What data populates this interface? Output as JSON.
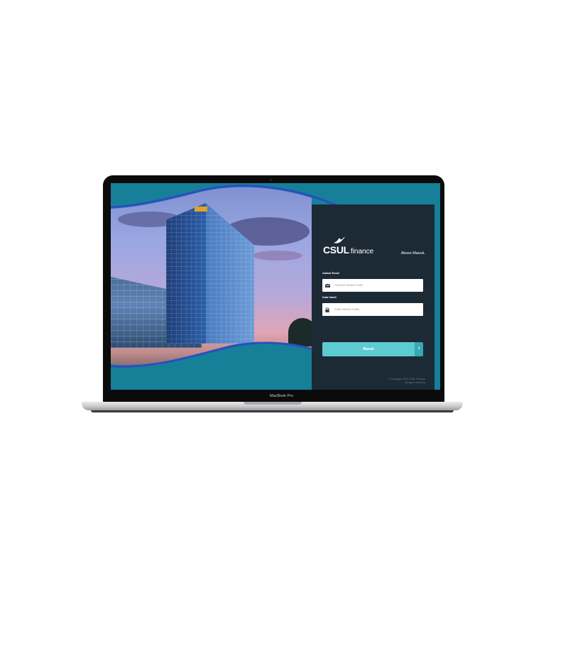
{
  "device": {
    "model_label": "MacBook Pro"
  },
  "login": {
    "brand_csul": "CSUL",
    "brand_finance": "finance",
    "heading": "Akses Masuk.",
    "email_label": "Alamat Email",
    "email_placeholder": "Alamat email Anda",
    "email_value": "",
    "password_label": "Kata Sandi",
    "password_placeholder": "Kata sandi Anda",
    "password_value": "",
    "submit_label": "Masuk",
    "help_label": "?",
    "copyright_line1": "© Copyright 2019 CSUL Finance",
    "copyright_line2": "All rights reserved"
  },
  "icons": {
    "email": "envelope-icon",
    "password": "lock-icon",
    "brand": "bird-icon"
  },
  "colors": {
    "screen_bg": "#168099",
    "panel_bg": "#1c2a35",
    "button": "#5ccbd2",
    "help_button": "#36a9b3",
    "wave_accent": "#2a4fc0"
  }
}
